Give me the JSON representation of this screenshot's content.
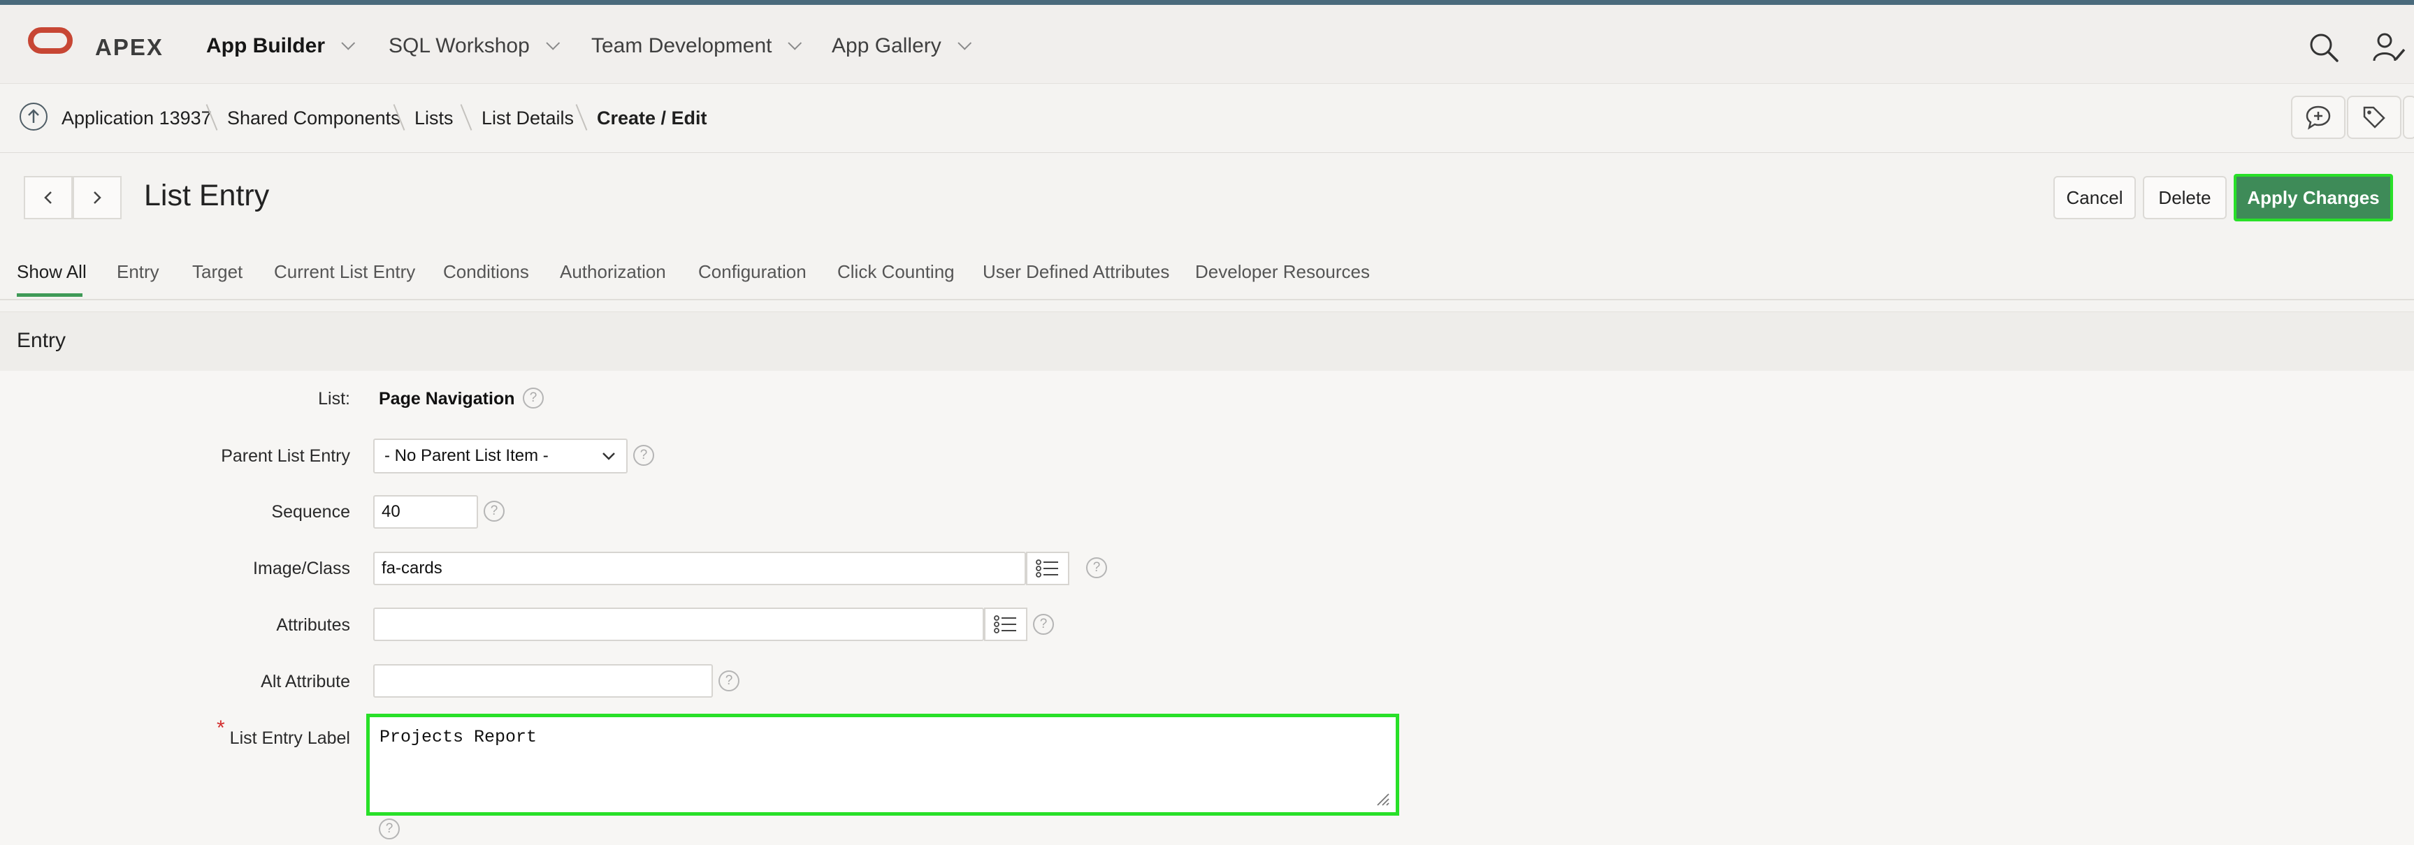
{
  "header": {
    "brand": "APEX",
    "nav": [
      {
        "label": "App Builder"
      },
      {
        "label": "SQL Workshop"
      },
      {
        "label": "Team Development"
      },
      {
        "label": "App Gallery"
      }
    ]
  },
  "breadcrumb": {
    "items": [
      "Application 13937",
      "Shared Components",
      "Lists",
      "List Details",
      "Create / Edit"
    ]
  },
  "page": {
    "title": "List Entry",
    "buttons": {
      "cancel": "Cancel",
      "delete": "Delete",
      "apply": "Apply Changes"
    }
  },
  "tabs": [
    "Show All",
    "Entry",
    "Target",
    "Current List Entry",
    "Conditions",
    "Authorization",
    "Configuration",
    "Click Counting",
    "User Defined Attributes",
    "Developer Resources"
  ],
  "section": {
    "title": "Entry"
  },
  "form": {
    "list": {
      "label": "List:",
      "value": "Page Navigation"
    },
    "parent": {
      "label": "Parent List Entry",
      "value": "- No Parent List Item -"
    },
    "sequence": {
      "label": "Sequence",
      "value": "40"
    },
    "image_class": {
      "label": "Image/Class",
      "value": "fa-cards"
    },
    "attributes": {
      "label": "Attributes",
      "value": ""
    },
    "alt_attribute": {
      "label": "Alt Attribute",
      "value": ""
    },
    "list_entry_label": {
      "label": "List Entry Label",
      "required_mark": "*",
      "value": "Projects Report"
    },
    "help_glyph": "?"
  },
  "colors": {
    "accent": "#3e8b58",
    "highlight": "#28e028",
    "brand": "#c74634"
  }
}
